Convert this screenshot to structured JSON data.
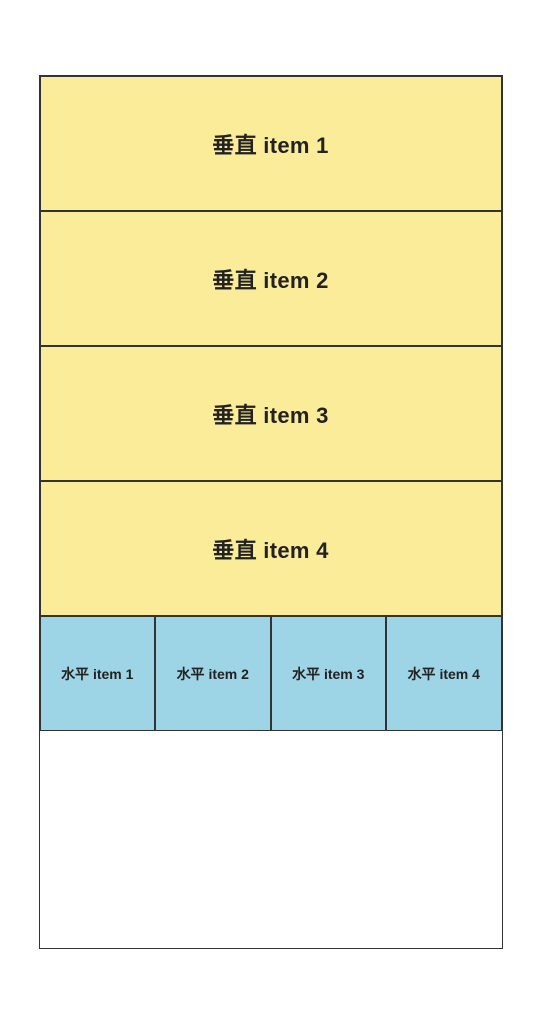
{
  "vertical": {
    "items": [
      {
        "label": "垂直 item 1"
      },
      {
        "label": "垂直 item 2"
      },
      {
        "label": "垂直 item 3"
      },
      {
        "label": "垂直 item 4"
      }
    ]
  },
  "horizontal": {
    "items": [
      {
        "label": "水平 item 1"
      },
      {
        "label": "水平 item 2"
      },
      {
        "label": "水平 item 3"
      },
      {
        "label": "水平 item 4"
      }
    ]
  },
  "colors": {
    "vertical_bg": "#fbec9a",
    "horizontal_bg": "#9ed5e6",
    "border": "#333333"
  }
}
